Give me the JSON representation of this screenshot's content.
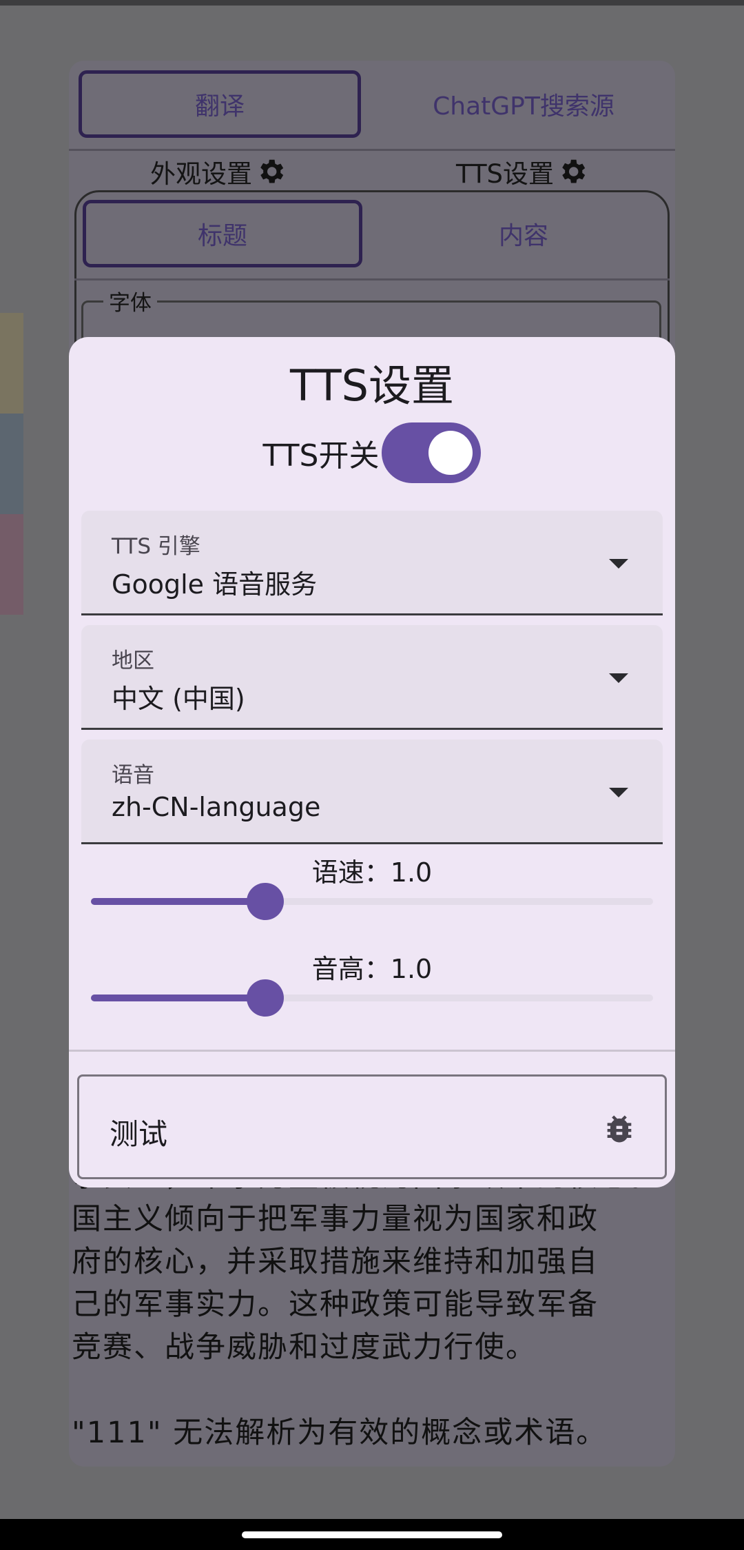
{
  "background": {
    "tabs": [
      "翻译",
      "ChatGPT搜索源"
    ],
    "settings": [
      "外观设置",
      "TTS设置"
    ],
    "inner_tabs": [
      "标题",
      "内容"
    ],
    "font_label": "字体",
    "text_lines": [
      "国主义倾向于把军事力量视为国家和政",
      "府的核心，并采取措施来维持和加强自",
      "己的军事实力。这种政策可能导致军备",
      "竞赛、战争威胁和过度武力行使。",
      "\"111\" 无法解析为有效的概念或术语。"
    ],
    "swatch_colors": [
      "#7a7460",
      "#5c6670",
      "#745c68"
    ]
  },
  "dialog": {
    "title": "TTS设置",
    "switch_label": "TTS开关",
    "switch_on": true,
    "engine": {
      "label": "TTS 引擎",
      "value": "Google 语音服务"
    },
    "region": {
      "label": "地区",
      "value": "中文 (中国)"
    },
    "voice": {
      "label": "语音",
      "value": "zh-CN-language"
    },
    "speed": {
      "label": "语速：1.0",
      "value": 1.0,
      "fraction": 0.31
    },
    "pitch": {
      "label": "音高：1.0",
      "value": 1.0,
      "fraction": 0.31
    },
    "test_button": "测试",
    "accent_color": "#6750a4"
  }
}
